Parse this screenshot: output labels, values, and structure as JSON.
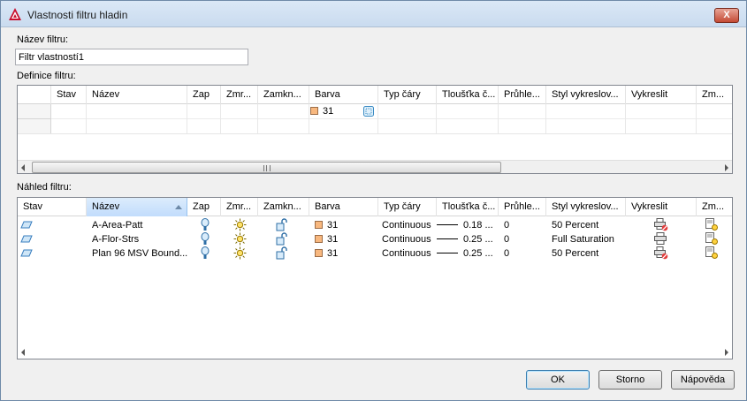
{
  "window": {
    "title": "Vlastnosti filtru hladin",
    "close_label": "X"
  },
  "filter_name": {
    "label": "Název filtru:",
    "value": "Filtr vlastností1"
  },
  "definition": {
    "label": "Definice filtru:",
    "columns": [
      "Stav",
      "Název",
      "Zap",
      "Zmr...",
      "Zamkn...",
      "Barva",
      "Typ čáry",
      "Tloušťka č...",
      "Průhle...",
      "Styl vykreslov...",
      "Vykreslit",
      "Zm..."
    ],
    "row": {
      "color": "31"
    }
  },
  "preview": {
    "label": "Náhled filtru:",
    "columns": [
      "Stav",
      "Název",
      "Zap",
      "Zmr...",
      "Zamkn...",
      "Barva",
      "Typ čáry",
      "Tloušťka č...",
      "Průhle...",
      "Styl vykreslov...",
      "Vykreslit",
      "Zm..."
    ],
    "rows": [
      {
        "name": "A-Area-Patt",
        "color": "31",
        "linetype": "Continuous",
        "lineweight": "0.18 ...",
        "transparency": "0",
        "plotstyle": "50 Percent",
        "plot": "no-plot"
      },
      {
        "name": "A-Flor-Strs",
        "color": "31",
        "linetype": "Continuous",
        "lineweight": "0.25 ...",
        "transparency": "0",
        "plotstyle": "Full Saturation",
        "plot": "plot"
      },
      {
        "name": "Plan 96 MSV Bound...",
        "color": "31",
        "linetype": "Continuous",
        "lineweight": "0.25 ...",
        "transparency": "0",
        "plotstyle": "50 Percent",
        "plot": "no-plot"
      }
    ]
  },
  "buttons": {
    "ok": "OK",
    "cancel": "Storno",
    "help": "Nápověda"
  },
  "colors": {
    "swatch": "#f8b87f",
    "sorted_header": "#c1dcfc"
  },
  "icons": [
    "autocad-logo-icon",
    "layer-status-icon",
    "lightbulb-on-icon",
    "sun-thaw-icon",
    "padlock-unlocked-icon",
    "printer-icon",
    "printer-no-plot-icon",
    "new-viewport-freeze-icon",
    "color-picker-icon"
  ]
}
